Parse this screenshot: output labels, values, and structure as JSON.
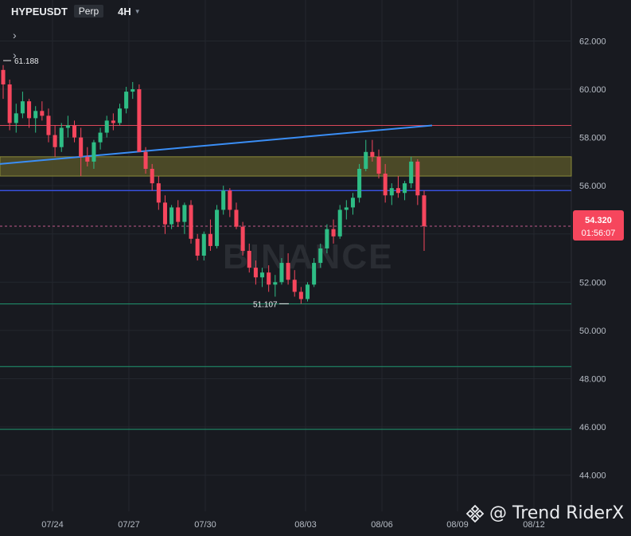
{
  "header": {
    "symbol": "HYPEUSDT",
    "contract": "Perp",
    "timeframe": "4H"
  },
  "watermark": {
    "exchange": "BINANCE",
    "author": "@ Trend RiderX"
  },
  "colors": {
    "bg": "#181a20",
    "grid": "#23272e",
    "text": "#b7bdc6",
    "up": "#2ebd85",
    "down": "#f6465d",
    "trendline": "#3a8ef6",
    "zone_fill": "#5c5a2a",
    "hline_blue": "#3d5afe",
    "hline_green": "#1e8a67",
    "hline_red": "#d9495a"
  },
  "chart_data": {
    "type": "candlestick",
    "x_ticks": [
      "07/24",
      "07/27",
      "07/30",
      "08/03",
      "08/06",
      "08/09",
      "08/12"
    ],
    "y_ticks": [
      "44.000",
      "46.000",
      "48.000",
      "50.000",
      "52.000",
      "54.000",
      "56.000",
      "58.000",
      "60.000",
      "62.000"
    ],
    "ylim": [
      42.5,
      63.7
    ],
    "current_price": "54.320",
    "countdown": "01:56:07",
    "labels": {
      "high": "61.188",
      "low": "51.107"
    },
    "candles": [
      [
        60.8,
        61.0,
        59.6,
        60.2
      ],
      [
        60.2,
        60.4,
        58.3,
        58.6
      ],
      [
        58.6,
        59.4,
        58.2,
        59.0
      ],
      [
        59.0,
        59.9,
        58.8,
        59.5
      ],
      [
        59.5,
        59.6,
        58.4,
        58.8
      ],
      [
        58.8,
        59.3,
        58.2,
        59.1
      ],
      [
        59.1,
        59.5,
        58.7,
        58.9
      ],
      [
        58.9,
        59.2,
        57.8,
        58.1
      ],
      [
        58.1,
        58.5,
        57.2,
        57.6
      ],
      [
        57.6,
        58.6,
        57.4,
        58.4
      ],
      [
        58.4,
        58.9,
        58.0,
        58.5
      ],
      [
        58.5,
        58.7,
        57.8,
        58.0
      ],
      [
        58.0,
        58.4,
        56.4,
        57.2
      ],
      [
        57.2,
        57.6,
        56.8,
        57.0
      ],
      [
        57.0,
        57.9,
        56.7,
        57.8
      ],
      [
        57.8,
        58.4,
        57.5,
        58.2
      ],
      [
        58.2,
        58.9,
        58.0,
        58.7
      ],
      [
        58.7,
        59.0,
        58.3,
        58.6
      ],
      [
        58.6,
        59.4,
        58.5,
        59.2
      ],
      [
        59.2,
        60.1,
        59.0,
        59.9
      ],
      [
        59.9,
        60.3,
        59.6,
        60.0
      ],
      [
        60.0,
        60.2,
        57.5,
        57.4
      ],
      [
        57.4,
        57.6,
        56.5,
        56.7
      ],
      [
        56.7,
        56.9,
        55.8,
        56.1
      ],
      [
        56.1,
        56.4,
        55.0,
        55.3
      ],
      [
        55.3,
        55.6,
        54.0,
        54.4
      ],
      [
        54.4,
        55.2,
        54.2,
        55.1
      ],
      [
        55.1,
        55.4,
        54.3,
        54.5
      ],
      [
        54.5,
        55.3,
        54.0,
        55.2
      ],
      [
        55.2,
        55.4,
        53.6,
        53.8
      ],
      [
        53.8,
        54.0,
        52.9,
        53.1
      ],
      [
        53.1,
        54.1,
        52.9,
        54.0
      ],
      [
        54.0,
        54.6,
        53.3,
        53.5
      ],
      [
        53.5,
        55.2,
        53.4,
        55.0
      ],
      [
        55.0,
        56.0,
        54.8,
        55.8
      ],
      [
        55.8,
        55.9,
        54.7,
        55.0
      ],
      [
        55.0,
        55.3,
        54.2,
        54.3
      ],
      [
        54.3,
        54.5,
        53.1,
        53.3
      ],
      [
        53.3,
        53.6,
        52.4,
        52.6
      ],
      [
        52.6,
        52.9,
        51.9,
        52.2
      ],
      [
        52.2,
        52.6,
        51.8,
        52.4
      ],
      [
        52.4,
        52.7,
        51.6,
        51.9
      ],
      [
        51.9,
        52.3,
        51.4,
        52.0
      ],
      [
        52.0,
        53.0,
        51.9,
        52.8
      ],
      [
        52.8,
        53.2,
        51.9,
        52.1
      ],
      [
        52.1,
        52.5,
        51.4,
        51.6
      ],
      [
        51.6,
        51.8,
        51.107,
        51.3
      ],
      [
        51.3,
        52.0,
        51.2,
        51.9
      ],
      [
        51.9,
        53.0,
        51.8,
        52.8
      ],
      [
        52.8,
        53.6,
        52.6,
        53.4
      ],
      [
        53.4,
        54.4,
        53.2,
        54.2
      ],
      [
        54.2,
        54.6,
        53.6,
        53.9
      ],
      [
        53.9,
        55.2,
        53.8,
        55.0
      ],
      [
        55.0,
        55.4,
        54.6,
        55.1
      ],
      [
        55.1,
        55.7,
        54.8,
        55.5
      ],
      [
        55.5,
        56.9,
        55.3,
        56.7
      ],
      [
        56.7,
        57.9,
        56.6,
        57.4
      ],
      [
        57.4,
        57.9,
        57.0,
        57.2
      ],
      [
        57.2,
        57.5,
        56.3,
        56.5
      ],
      [
        56.5,
        56.9,
        55.3,
        55.6
      ],
      [
        55.6,
        56.1,
        55.2,
        55.9
      ],
      [
        55.9,
        56.4,
        55.5,
        55.7
      ],
      [
        55.7,
        56.2,
        55.4,
        56.1
      ],
      [
        56.1,
        57.2,
        55.9,
        57.0
      ],
      [
        57.0,
        57.1,
        55.2,
        55.6
      ],
      [
        55.6,
        55.8,
        53.3,
        54.32
      ]
    ],
    "overlays": {
      "trendline": {
        "from": [
          56.9
        ],
        "to": [
          58.5
        ]
      },
      "zone": [
        56.4,
        57.2
      ],
      "hline_blue": 55.8,
      "hline_dashed": 54.32,
      "hline_red": 58.5,
      "hline_green": [
        51.1,
        48.5,
        45.9
      ]
    }
  }
}
